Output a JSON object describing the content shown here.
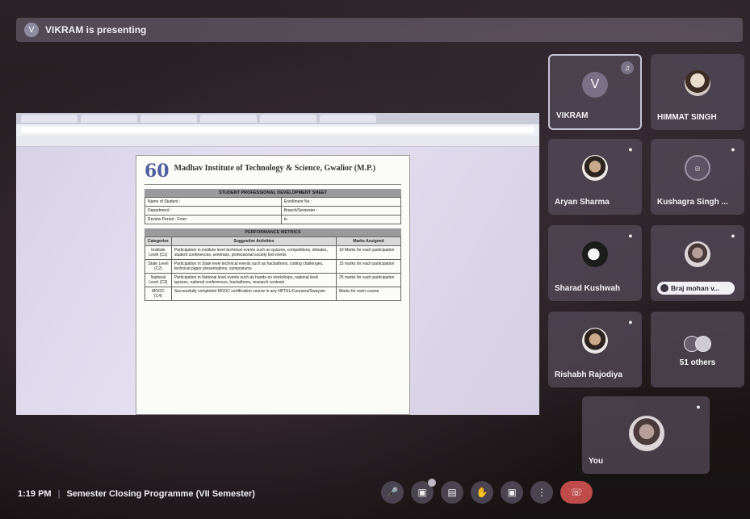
{
  "presenter_bar": {
    "text": "VIKRAM is presenting",
    "initial": "V"
  },
  "shared_document": {
    "logo_text": "60",
    "institute": "Madhav Institute of Technology & Science, Gwalior (M.P.)",
    "sheet_title": "STUDENT PROFESSIONAL DEVELOPMENT SHEET",
    "fields": [
      [
        "Name of Student :",
        "Enrollment No :"
      ],
      [
        "Department :",
        "Branch/Semester :"
      ],
      [
        "Review Period : From",
        "to"
      ]
    ],
    "metrics_title": "PERFORMANCE METRICS",
    "metrics_headers": [
      "Categories",
      "Suggestive Activities",
      "Marks Assigned"
    ],
    "metrics_rows": [
      [
        "Institute Level (C1)",
        "Participation in institute level technical events such as quizzes, competitions, debates, student conferences, seminars, professional society led events",
        "10 Marks for each participation"
      ],
      [
        "State Level (C2)",
        "Participation in State level technical events such as hackathons, coding challenges, technical paper presentations, symposiums",
        "15 marks for each participation"
      ],
      [
        "National Level (C3)",
        "Participation in National level events such as hands-on workshops, national level quizzes, national conferences, hackathons, research contests",
        "25 marks for each participation"
      ],
      [
        "MOOC (C4)",
        "Successfully completed MOOC certification course in any NPTEL/Coursera/Swayam",
        "Marks for each course"
      ]
    ]
  },
  "participants": [
    {
      "name": "VIKRAM",
      "initial": "V"
    },
    {
      "name": "HIMMAT SINGH"
    },
    {
      "name": "Aryan Sharma"
    },
    {
      "name": "Kushagra Singh ..."
    },
    {
      "name": "Sharad Kushwah"
    },
    {
      "name": "Braj mohan v..."
    },
    {
      "name": "Rishabh Rajodiya"
    },
    {
      "name": "51 others"
    },
    {
      "name": "You"
    }
  ],
  "meeting_info": {
    "time": "1:19 PM",
    "title": "Semester Closing Programme (VII Semester)"
  },
  "controls": {
    "mic": "mic-icon",
    "camera": "camera-off-icon",
    "captions": "captions-icon",
    "raise_hand": "hand-icon",
    "present": "present-icon",
    "more": "more-icon",
    "hangup": "hangup-icon"
  }
}
